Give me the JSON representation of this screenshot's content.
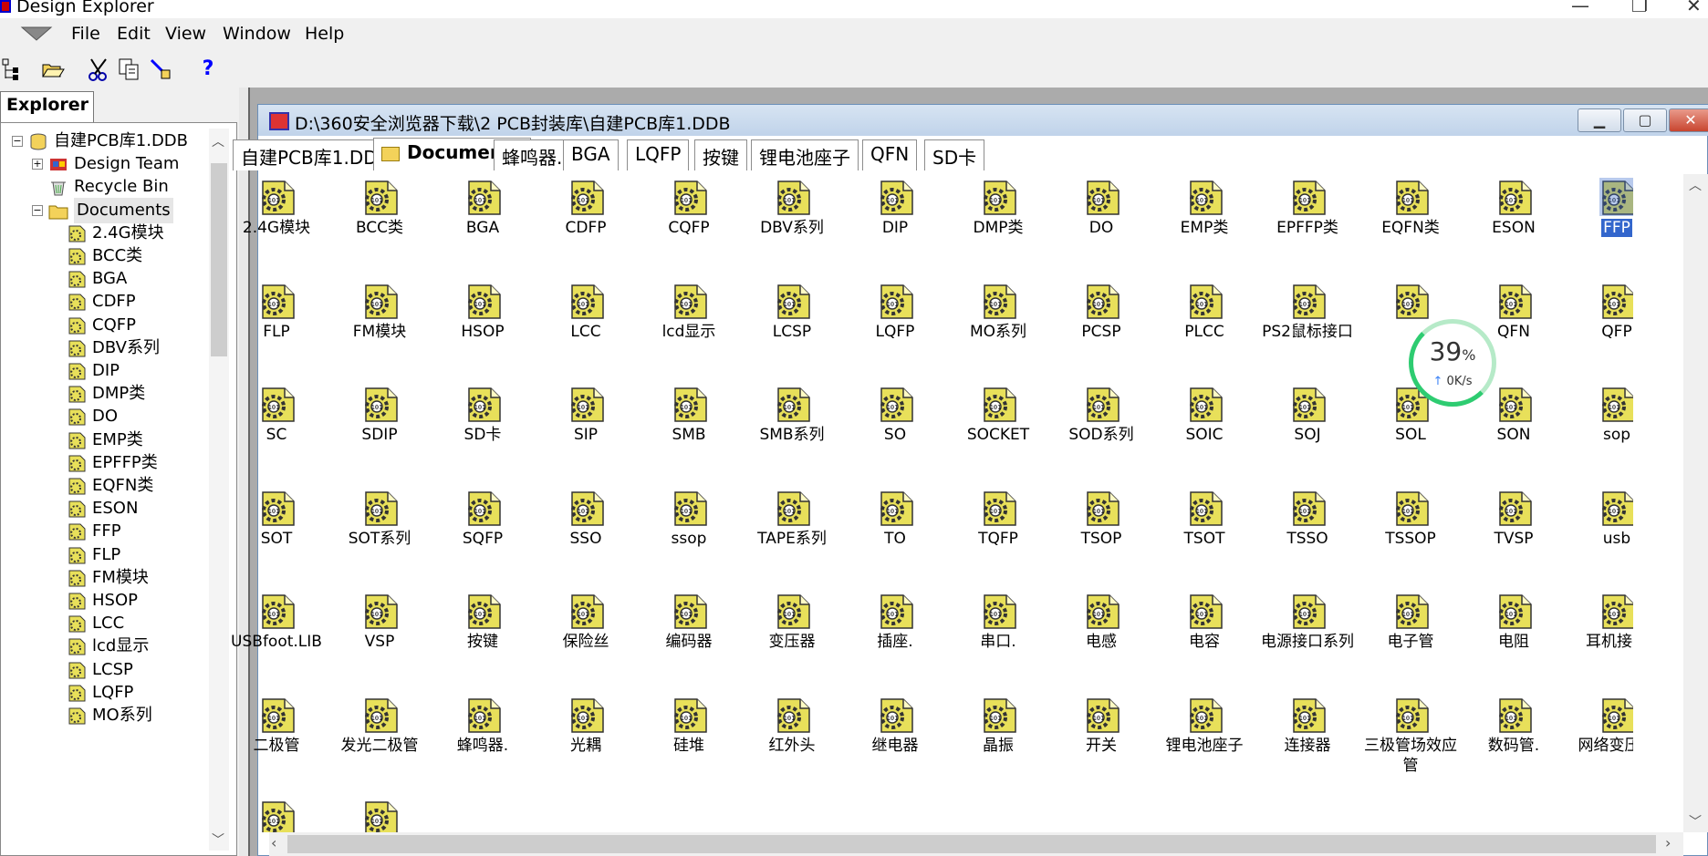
{
  "window": {
    "title": "Design Explorer"
  },
  "menu": [
    "File",
    "Edit",
    "View",
    "Window",
    "Help"
  ],
  "toolbar": {
    "help_glyph": "?"
  },
  "explorer": {
    "tab_label": "Explorer",
    "tree": [
      {
        "label": "自建PCB库1.DDB",
        "level": 0,
        "icon": "database-icon",
        "toggle": "−"
      },
      {
        "label": "Design Team",
        "level": 1,
        "icon": "team-icon",
        "toggle": "+"
      },
      {
        "label": "Recycle Bin",
        "level": 1,
        "icon": "recycle-bin-icon",
        "toggle": ""
      },
      {
        "label": "Documents",
        "level": 1,
        "icon": "folder-icon",
        "toggle": "−",
        "selected": true
      },
      {
        "label": "2.4G模块",
        "level": 2,
        "icon": "library-icon"
      },
      {
        "label": "BCC类",
        "level": 2,
        "icon": "library-icon"
      },
      {
        "label": "BGA",
        "level": 2,
        "icon": "library-icon"
      },
      {
        "label": "CDFP",
        "level": 2,
        "icon": "library-icon"
      },
      {
        "label": "CQFP",
        "level": 2,
        "icon": "library-icon"
      },
      {
        "label": "DBV系列",
        "level": 2,
        "icon": "library-icon"
      },
      {
        "label": "DIP",
        "level": 2,
        "icon": "library-icon"
      },
      {
        "label": "DMP类",
        "level": 2,
        "icon": "library-icon"
      },
      {
        "label": "DO",
        "level": 2,
        "icon": "library-icon"
      },
      {
        "label": "EMP类",
        "level": 2,
        "icon": "library-icon"
      },
      {
        "label": "EPFFP类",
        "level": 2,
        "icon": "library-icon"
      },
      {
        "label": "EQFN类",
        "level": 2,
        "icon": "library-icon"
      },
      {
        "label": "ESON",
        "level": 2,
        "icon": "library-icon"
      },
      {
        "label": "FFP",
        "level": 2,
        "icon": "library-icon"
      },
      {
        "label": "FLP",
        "level": 2,
        "icon": "library-icon"
      },
      {
        "label": "FM模块",
        "level": 2,
        "icon": "library-icon"
      },
      {
        "label": "HSOP",
        "level": 2,
        "icon": "library-icon"
      },
      {
        "label": "LCC",
        "level": 2,
        "icon": "library-icon"
      },
      {
        "label": "lcd显示",
        "level": 2,
        "icon": "library-icon"
      },
      {
        "label": "LCSP",
        "level": 2,
        "icon": "library-icon"
      },
      {
        "label": "LQFP",
        "level": 2,
        "icon": "library-icon"
      },
      {
        "label": "MO系列",
        "level": 2,
        "icon": "library-icon"
      }
    ]
  },
  "document_window": {
    "title": "D:\\360安全浏览器下载\\2 PCB封装库\\自建PCB库1.DDB",
    "tabs": [
      {
        "label": "自建PCB库1.DDB"
      },
      {
        "label": "Documents",
        "active": true,
        "folder": true
      },
      {
        "label": "蜂鸣器."
      },
      {
        "label": "BGA"
      },
      {
        "label": "LQFP"
      },
      {
        "label": "按键"
      },
      {
        "label": "锂电池座子"
      },
      {
        "label": "QFN"
      },
      {
        "label": "SD卡"
      }
    ],
    "items": [
      "2.4G模块",
      "BCC类",
      "BGA",
      "CDFP",
      "CQFP",
      "DBV系列",
      "DIP",
      "DMP类",
      "DO",
      "EMP类",
      "EPFFP类",
      "EQFN类",
      "ESON",
      "FFP",
      "FLP",
      "FM模块",
      "HSOP",
      "LCC",
      "lcd显示",
      "LCSP",
      "LQFP",
      "MO系列",
      "PCSP",
      "PLCC",
      "PS2鼠标接口",
      "",
      "QFN",
      "QFP",
      "SC",
      "SDIP",
      "SD卡",
      "SIP",
      "SMB",
      "SMB系列",
      "SO",
      "SOCKET",
      "SOD系列",
      "SOIC",
      "SOJ",
      "SOL",
      "SON",
      "sop",
      "SOT",
      "SOT系列",
      "SQFP",
      "SSO",
      "ssop",
      "TAPE系列",
      "TO",
      "TQFP",
      "TSOP",
      "TSOT",
      "TSSO",
      "TSSOP",
      "TVSP",
      "usb",
      "USBfoot.LIB",
      "VSP",
      "按键",
      "保险丝",
      "编码器",
      "变压器",
      "插座.",
      "串口.",
      "电感",
      "电容",
      "电源接口系列",
      "电子管",
      "电阻",
      "耳机接口",
      "二极管",
      "发光二极管",
      "蜂鸣器.",
      "光耦",
      "硅堆",
      "红外头",
      "继电器",
      "晶振",
      "开关",
      "锂电池座子",
      "连接器",
      "三极管场效应管",
      "数码管.",
      "网络变压器",
      "",
      ""
    ],
    "selected_item": "FFP"
  },
  "speed_widget": {
    "percent": "39",
    "percent_unit": "%",
    "rate": "0K/s",
    "arrow": "↑"
  },
  "colors": {
    "accent": "#3366cc",
    "icon_yellow": "#e8e05a",
    "speed_green": "#2ecc71"
  }
}
